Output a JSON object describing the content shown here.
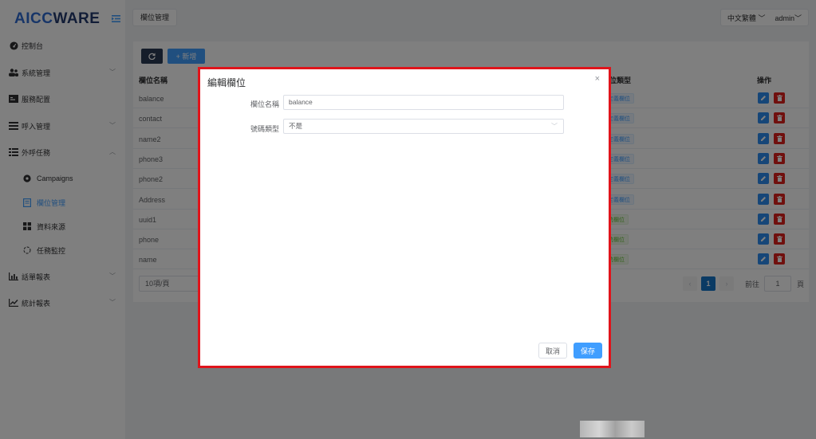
{
  "brand": {
    "part1": "AICC",
    "part2": "WARE"
  },
  "colors": {
    "primary": "#409eff",
    "dark_button": "#2b3a55",
    "danger": "#e0201d",
    "highlight_border": "#e0141b"
  },
  "sidebar": {
    "items": [
      {
        "label": "控制台",
        "icon": "dashboard-icon"
      },
      {
        "label": "系統管理",
        "icon": "users-icon"
      },
      {
        "label": "服務配置",
        "icon": "server-icon"
      },
      {
        "label": "呼入管理",
        "icon": "list-icon"
      },
      {
        "label": "外呼任務",
        "icon": "tasks-icon"
      },
      {
        "label": "Campaigns",
        "icon": "campaign-icon"
      },
      {
        "label": "欄位管理",
        "icon": "field-icon"
      },
      {
        "label": "資料來源",
        "icon": "grid-icon"
      },
      {
        "label": "任務監控",
        "icon": "monitor-icon"
      },
      {
        "label": "話單報表",
        "icon": "bar-chart-icon"
      },
      {
        "label": "統計報表",
        "icon": "line-chart-icon"
      }
    ]
  },
  "topbar": {
    "breadcrumb": "欄位管理",
    "language": "中文繁體",
    "user": "admin"
  },
  "toolbar": {
    "add_label": "+ 新增"
  },
  "table": {
    "headers": {
      "name": "欄位名稱",
      "type": "位類型",
      "actions": "操作"
    },
    "rows": [
      {
        "name": "balance",
        "tag": "定義欄位"
      },
      {
        "name": "contact",
        "tag": "定義欄位"
      },
      {
        "name": "name2",
        "tag": "定義欄位"
      },
      {
        "name": "phone3",
        "tag": "定義欄位"
      },
      {
        "name": "phone2",
        "tag": "定義欄位"
      },
      {
        "name": "Address",
        "tag": "定義欄位"
      },
      {
        "name": "uuid1",
        "tag": "統欄位"
      },
      {
        "name": "phone",
        "tag": "統欄位"
      },
      {
        "name": "name",
        "tag": "統欄位"
      }
    ]
  },
  "pagination": {
    "page_size": "10項/頁",
    "current": "1",
    "goto_label": "前往",
    "goto_value": "1",
    "page_suffix": "頁"
  },
  "modal": {
    "title": "編輯欄位",
    "close": "×",
    "field_name_label": "欄位名稱",
    "field_name_value": "balance",
    "number_type_label": "號碼類型",
    "number_type_value": "不是",
    "cancel_label": "取消",
    "save_label": "保存"
  }
}
